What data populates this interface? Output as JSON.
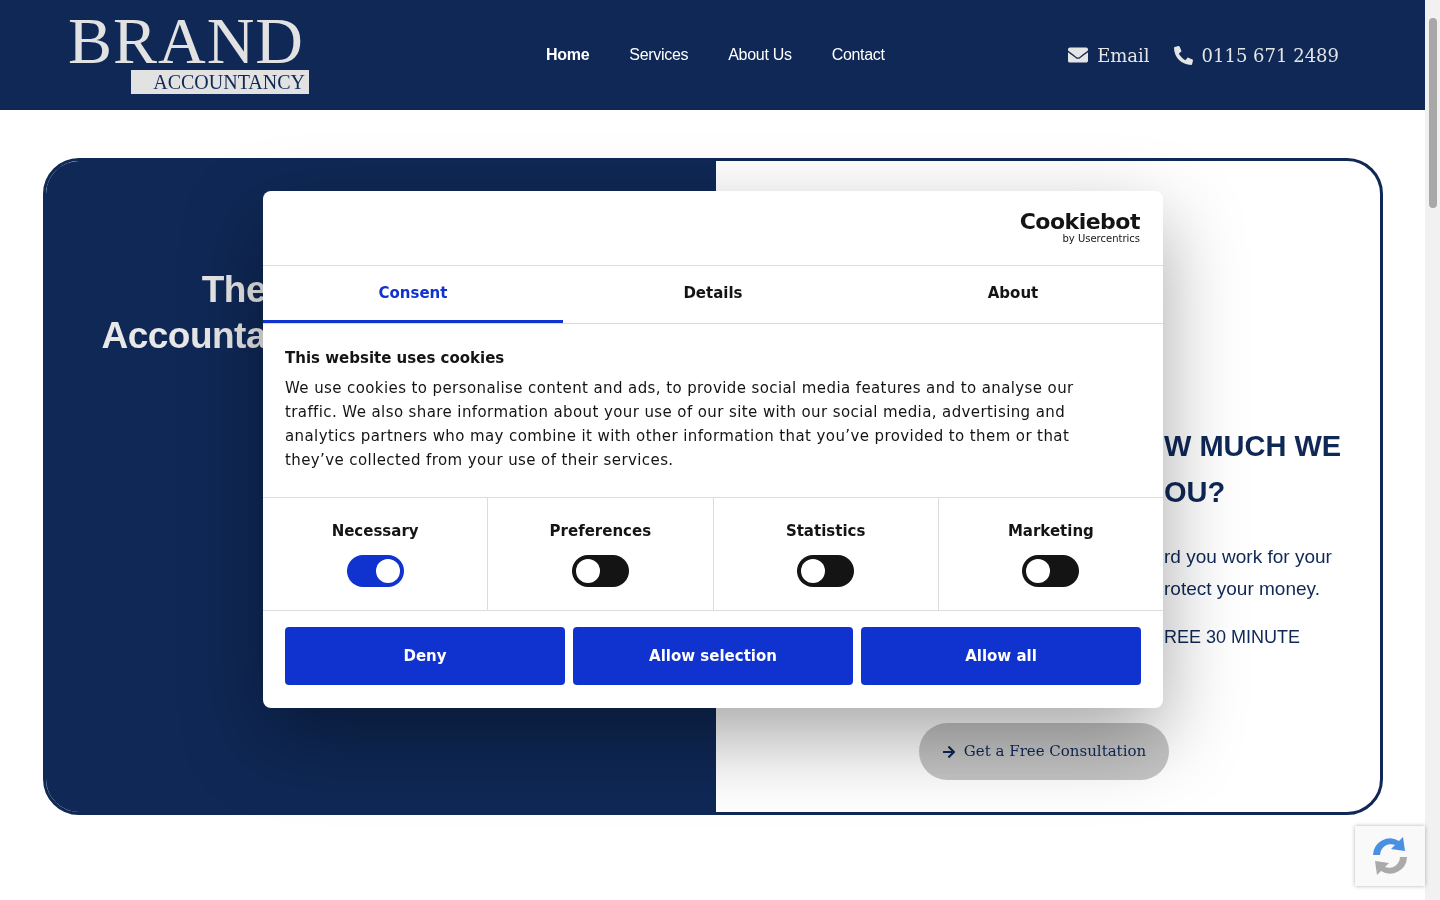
{
  "header": {
    "logo": {
      "word": "BRAND",
      "subtitle": "ACCOUNTANCY"
    },
    "nav": [
      {
        "label": "Home",
        "selected": true
      },
      {
        "label": "Services",
        "selected": false
      },
      {
        "label": "About Us",
        "selected": false
      },
      {
        "label": "Contact",
        "selected": false
      }
    ],
    "contacts": [
      {
        "kind": "email",
        "label": "Email"
      },
      {
        "kind": "phone",
        "label": "0115 671 2489"
      }
    ]
  },
  "hero": {
    "left_lines": [
      "The",
      "Accounta"
    ],
    "heading_lines": [
      "W MUCH WE",
      "OU?"
    ],
    "body_lines": [
      "rd you work for your",
      "rotect your money."
    ],
    "offer": "REE 30 MINUTE",
    "cta": "Get a Free Consultation"
  },
  "cookie_dialog": {
    "brand": {
      "name": "Cookiebot",
      "byline": "by Usercentrics"
    },
    "tabs": [
      {
        "label": "Consent",
        "selected": true
      },
      {
        "label": "Details",
        "selected": false
      },
      {
        "label": "About",
        "selected": false
      }
    ],
    "title": "This website uses cookies",
    "text": "We use cookies to personalise content and ads, to provide social media features and to analyse our traffic. We also share information about your use of our site with our social media, advertising and analytics partners who may combine it with other information that you’ve provided to them or that they’ve collected from your use of their services.",
    "categories": [
      {
        "label": "Necessary",
        "on": true
      },
      {
        "label": "Preferences",
        "on": false
      },
      {
        "label": "Statistics",
        "on": false
      },
      {
        "label": "Marketing",
        "on": false
      }
    ],
    "buttons": [
      "Deny",
      "Allow selection",
      "Allow all"
    ]
  }
}
